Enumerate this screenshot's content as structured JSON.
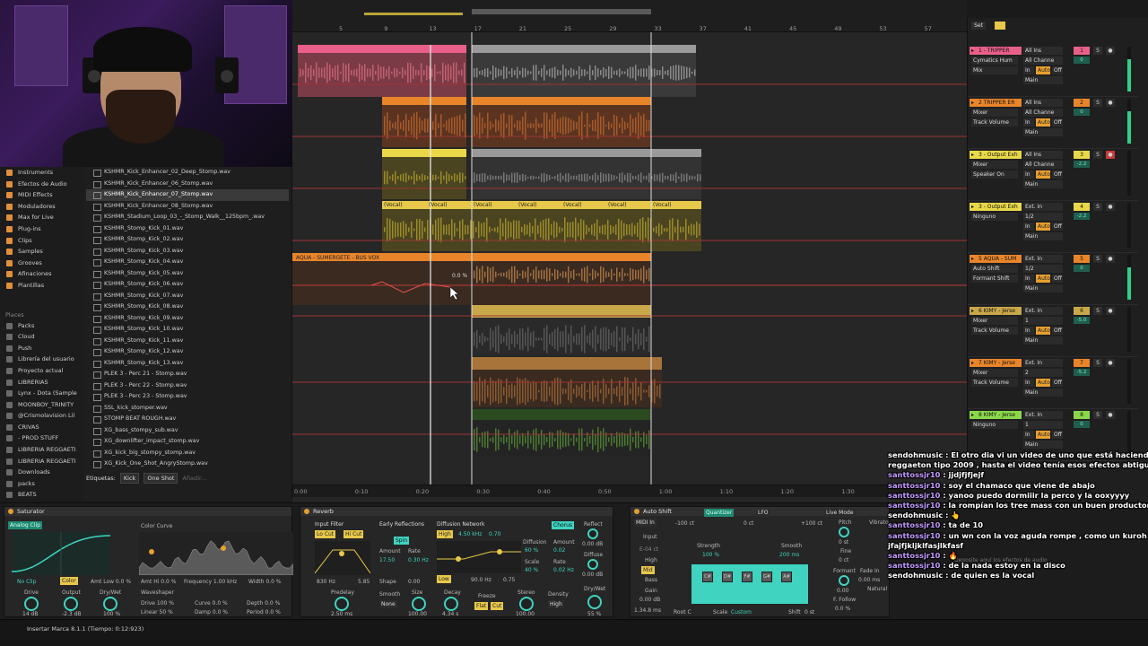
{
  "browser": {
    "categories": [
      {
        "label": "Instruments",
        "color": "#e08f3a"
      },
      {
        "label": "Efectos de Audio",
        "color": "#e08f3a"
      },
      {
        "label": "MIDI Effects",
        "color": "#e08f3a"
      },
      {
        "label": "Moduladores",
        "color": "#e08f3a"
      },
      {
        "label": "Max for Live",
        "color": "#e08f3a"
      },
      {
        "label": "Plug-ins",
        "color": "#e08f3a"
      },
      {
        "label": "Clips",
        "color": "#e08f3a"
      },
      {
        "label": "Samples",
        "color": "#e08f3a"
      },
      {
        "label": "Grooves",
        "color": "#e08f3a"
      },
      {
        "label": "Afinaciones",
        "color": "#e08f3a"
      },
      {
        "label": "Plantillas",
        "color": "#e08f3a"
      }
    ],
    "places_heading": "Places",
    "places": [
      {
        "label": "Packs"
      },
      {
        "label": "Cloud"
      },
      {
        "label": "Push"
      },
      {
        "label": "Librería del usuario"
      },
      {
        "label": "Proyecto actual"
      },
      {
        "label": "LIBRERIAS"
      },
      {
        "label": "Lynx - Dota (Sample"
      },
      {
        "label": "MOONBOY_TRINITY"
      },
      {
        "label": "@Crismolavision Lil"
      },
      {
        "label": "CRIVAS"
      },
      {
        "label": "- PROD STUFF"
      },
      {
        "label": "LIBRERIA REGGAETI"
      },
      {
        "label": "LIBRERIA REGGAETI"
      },
      {
        "label": "Downloads"
      },
      {
        "label": "packs"
      },
      {
        "label": "BEATS"
      }
    ],
    "files": [
      "KSHMR_Kick_Enhancer_02_Deep_Stomp.wav",
      "KSHMR_Kick_Enhancer_06_Stomp.wav",
      "KSHMR_Kick_Enhancer_07_Stomp.wav",
      "KSHMR_Kick_Enhancer_08_Stomp.wav",
      "KSHMR_Stadium_Loop_03_-_Stomp_Walk__125bpm_.wav",
      "KSHMR_Stomp_Kick_01.wav",
      "KSHMR_Stomp_Kick_02.wav",
      "KSHMR_Stomp_Kick_03.wav",
      "KSHMR_Stomp_Kick_04.wav",
      "KSHMR_Stomp_Kick_05.wav",
      "KSHMR_Stomp_Kick_06.wav",
      "KSHMR_Stomp_Kick_07.wav",
      "KSHMR_Stomp_Kick_08.wav",
      "KSHMR_Stomp_Kick_09.wav",
      "KSHMR_Stomp_Kick_10.wav",
      "KSHMR_Stomp_Kick_11.wav",
      "KSHMR_Stomp_Kick_12.wav",
      "KSHMR_Stomp_Kick_13.wav",
      "PLEK 3 - Perc 21 - Stomp.wav",
      "PLEK 3 - Perc 22 - Stomp.wav",
      "PLEK 3 - Perc 23 - Stomp.wav",
      "SSL_kick_stomper.wav",
      "STOMP BEAT ROUGH.wav",
      "XG_bass_stompy_sub.wav",
      "XG_downlifter_impact_stomp.wav",
      "XG_kick_big_stompy_stomp.wav",
      "XG_Kick_One_Shot_AngryStomp.wav"
    ],
    "selected_file_index": 2,
    "tags_label": "Etiquetas:",
    "tags": [
      "Kick",
      "One Shot"
    ],
    "tags_add": "Añadir..."
  },
  "arrangement": {
    "bar_numbers": [
      "5",
      "9",
      "13",
      "17",
      "21",
      "25",
      "29",
      "33",
      "37",
      "41",
      "45",
      "49",
      "53",
      "57"
    ],
    "time_labels": [
      "0:00",
      "0:10",
      "0:20",
      "0:30",
      "0:40",
      "0:50",
      "1:00",
      "1:10",
      "1:20",
      "1:30"
    ],
    "vocal_clip_name": "(Vocal)",
    "bus_clip_name": "AQUA - SUMERGETE - BUS VOX",
    "automation_value": "0.0 %",
    "set_label": "Set"
  },
  "mixer": {
    "tracks": [
      {
        "name": "1 - TRIPPER",
        "color": "#e8608a",
        "input": "All Ins",
        "channel": "All Channe",
        "device": "Cymatics Hum",
        "mode": "Mix",
        "num": "1",
        "vol": "0"
      },
      {
        "name": "2 TRIPPER ER",
        "color": "#e8852a",
        "input": "All Ins",
        "channel": "All Channe",
        "device": "Mixer",
        "mode": "Track Volume",
        "num": "2",
        "vol": "0"
      },
      {
        "name": "3 - Output Exh",
        "color": "#e8d84a",
        "input": "All Ins",
        "channel": "All Channe",
        "device": "Mixer",
        "mode": "Speaker On",
        "num": "3",
        "vol": "-2.2"
      },
      {
        "name": "3 - Output Exh",
        "color": "#e8d84a",
        "input": "Ext. In",
        "channel": "1/2",
        "device": "Ninguno",
        "mode": "",
        "num": "4",
        "vol": "-2.2"
      },
      {
        "name": "5 AQUA - SUM",
        "color": "#e8852a",
        "input": "Ext. In",
        "channel": "1/2",
        "device": "Auto Shift",
        "mode": "Formant Shift",
        "num": "5",
        "vol": "0"
      },
      {
        "name": "6 KIMY - Jerse",
        "color": "#c9a84a",
        "input": "Ext. In",
        "channel": "1",
        "device": "Mixer",
        "mode": "Track Volume",
        "num": "6",
        "vol": "-5.0"
      },
      {
        "name": "7 KIMY - Jerse",
        "color": "#e8852a",
        "input": "Ext. In",
        "channel": "2",
        "device": "Mixer",
        "mode": "Track Volume",
        "num": "7",
        "vol": "-5.2"
      },
      {
        "name": "8 KIMY - Jerse",
        "color": "#8ad84a",
        "input": "Ext. In",
        "channel": "1",
        "device": "Ninguno",
        "mode": "",
        "num": "8",
        "vol": "0"
      }
    ],
    "route_main": "Main",
    "route_in": "In",
    "route_auto": "Auto",
    "route_off": "Off"
  },
  "devices": {
    "saturator": {
      "title": "Saturator",
      "mode": "Analog Clip",
      "clip": "No Clip",
      "color": "Color",
      "amt_low": "Amt Low 0.0 %",
      "amt_hi": "Amt Hi 0.0 %",
      "frequency": "Frequency 1.00 kHz",
      "width": "Width 0.0 %",
      "curve": "Color Curve",
      "waveshaper": "Waveshaper",
      "drive_l": "Drive",
      "output_l": "Output",
      "drywet_l": "Dry/Wet",
      "drive": "14 dB",
      "output": "-2.3 dB",
      "drywet": "100 %",
      "ws_drive": "Drive 100 %",
      "ws_curve": "Curve 0.0 %",
      "ws_depth": "Depth 0.0 %",
      "ws_lin": "Linear 50 %",
      "ws_damp": "Damp 0.0 %",
      "ws_period": "Period 0.0 %"
    },
    "reverb": {
      "title": "Reverb",
      "input_filter": "Input Filter",
      "lo_cut": "Lo Cut",
      "hi_cut": "Hi Cut",
      "freq1": "830 Hz",
      "freq2": "5.85",
      "early": "Early Reflections",
      "spin": "Spin",
      "amount": "Amount",
      "rate": "Rate",
      "amount_v": "17.50",
      "rate_v": "0.30 Hz",
      "shape": "Shape",
      "shape_v": "0.00",
      "diffusion_net": "Diffusion Network",
      "high": "High",
      "khz": "4.50 kHz",
      "ratio": "0.70",
      "low": "Low",
      "hz90": "90.0 Hz",
      "ratio2": "0.75",
      "diffusion": "Diffusion",
      "diff_v": "60 %",
      "scale": "Scale",
      "scale_v": "40 %",
      "chorus": "Chorus",
      "amount2": "Amount",
      "amount2_v": "0.02",
      "rate2": "Rate",
      "rate2_v": "0.02 Hz",
      "reflect": "Reflect",
      "reflect_v": "0.00 dB",
      "diffuse": "Diffuse",
      "diffuse_v": "0.00 dB",
      "predelay": "Predelay",
      "predelay_v": "2.50 ms",
      "smooth": "Smooth",
      "smooth_v": "None",
      "size": "Size",
      "size_v": "100.00",
      "decay": "Decay",
      "decay_v": "4.34 s",
      "freeze": "Freeze",
      "flat": "Flat",
      "cut": "Cut",
      "stereo": "Stereo",
      "stereo_v": "100.00",
      "density": "Density",
      "density_v": "High",
      "drywet": "Dry/Wet",
      "drywet_v": "55 %"
    },
    "autoshift": {
      "title": "Auto Shift",
      "midi_in": "MIDI In",
      "input": "Input",
      "quantizer": "Quantizer",
      "lfo": "LFO",
      "live_mode": "Live Mode",
      "cents_low": "-100 ct",
      "cents_mid": "0 ct",
      "cents_high": "+100 ct",
      "e_label": "E-04 ct",
      "strength": "Strength",
      "strength_v": "100 %",
      "smooth": "Smooth",
      "smooth_v": "200 ms",
      "high": "High",
      "mid": "Mid",
      "bass": "Bass",
      "gain": "Gain",
      "gain_v": "0.00 dB",
      "gain2": "1.34.8 ms",
      "root": "Root C",
      "scale": "Scale",
      "scale_v": "Custom",
      "shift": "Shift",
      "shift_v": "0 st",
      "pitch": "Pitch",
      "pitch_v": "0 st",
      "fine": "Fine",
      "fine_v": "0 ct",
      "formant": "Formant",
      "formant_v": "0.00",
      "ffollow": "F. Follow",
      "ffollow_v": "0.0 %",
      "vibrato": "Vibrato",
      "fade": "Fade In",
      "fade_v": "0.00 ms",
      "natural": "Natural",
      "keys": [
        "C#",
        "D#",
        "F#",
        "G#",
        "A#"
      ],
      "drop_hint": "Deposite aquí los efectos de audio"
    }
  },
  "status": {
    "text": "Insertar Marca 8.1.1 (Tiempo: 0:12:923)"
  },
  "chat": [
    {
      "user": "sendohmusic",
      "color": "#ffffff",
      "text": "El otro dia vi un video de uno que está haciend"
    },
    {
      "user": "",
      "color": "#ffffff",
      "text": "reggaeton tipo 2009 , hasta el video tenía esos efectos abtiguos"
    },
    {
      "user": "santtossjr10",
      "color": "#c39bff",
      "text": "jjdjfjfjejf"
    },
    {
      "user": "santtossjr10",
      "color": "#c39bff",
      "text": "soy el chamaco que viene de abajo"
    },
    {
      "user": "santtossjr10",
      "color": "#c39bff",
      "text": "yanoo puedo dormiiir la perco y la ooxyyyy"
    },
    {
      "user": "santtossjr10",
      "color": "#c39bff",
      "text": "la rompían los tree mass con un buen productor"
    },
    {
      "user": "sendohmusic",
      "color": "#ffffff",
      "text": "👆"
    },
    {
      "user": "santtossjr10",
      "color": "#c39bff",
      "text": "ta de 10"
    },
    {
      "user": "santtossjr10",
      "color": "#c39bff",
      "text": "un wn con la voz aguda rompe , como un kuroh"
    },
    {
      "user": "",
      "color": "#ffffff",
      "text": "jfajfjkljklfasjlkfasf"
    },
    {
      "user": "santtossjr10",
      "color": "#c39bff",
      "text": "🔥"
    },
    {
      "user": "santtossjr10",
      "color": "#c39bff",
      "text": "de la nada estoy en la disco"
    },
    {
      "user": "sendohmusic",
      "color": "#ffffff",
      "text": "de quien es la vocal"
    }
  ]
}
